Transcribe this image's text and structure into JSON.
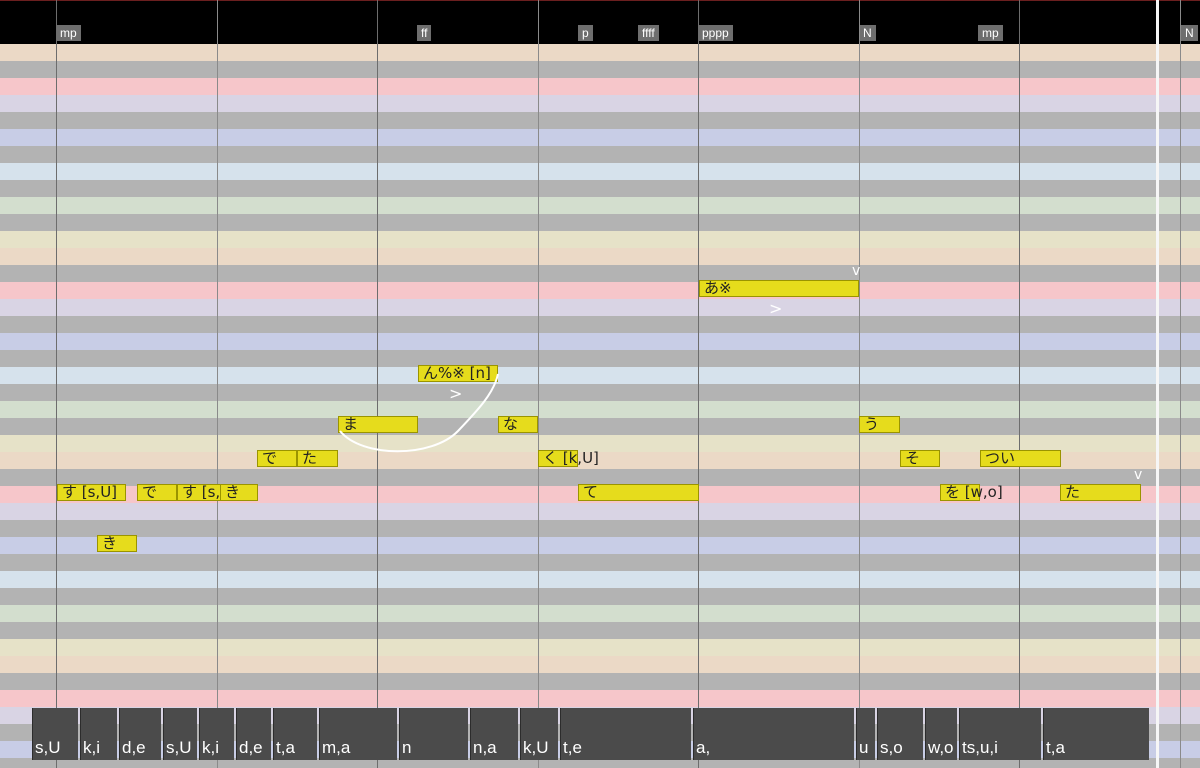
{
  "colors": {
    "note_fill": "#e6dc1c",
    "row_palette": [
      "#ebd9c6",
      "#b3b3b3",
      "#f6c6ca",
      "#d9d4e4",
      "#b3b3b3",
      "#c8cde6",
      "#b3b3b3",
      "#d6e2ec",
      "#b3b3b3",
      "#d3dece",
      "#b3b3b3",
      "#e6e2c8"
    ]
  },
  "dynamics": [
    "mp",
    "ff",
    "p",
    "ffff",
    "pppp",
    "N",
    "mp",
    "N"
  ],
  "notes": [
    {
      "lyric": "す [s,U]"
    },
    {
      "lyric": "で"
    },
    {
      "lyric": "す [s,"
    },
    {
      "lyric": "き"
    },
    {
      "lyric": "き"
    },
    {
      "lyric": "で"
    },
    {
      "lyric": "た"
    },
    {
      "lyric": "ま"
    },
    {
      "lyric": "ん%※ [n]"
    },
    {
      "lyric": "な"
    },
    {
      "lyric": "く [k,U]"
    },
    {
      "lyric": "て"
    },
    {
      "lyric": "あ※"
    },
    {
      "lyric": "う"
    },
    {
      "lyric": "そ"
    },
    {
      "lyric": "つい"
    },
    {
      "lyric": "を [w,o]"
    },
    {
      "lyric": "た"
    }
  ],
  "accents": [
    ">",
    ">"
  ],
  "accent_marks": [
    "v",
    "v"
  ],
  "phonemes": [
    "s,U",
    "k,i",
    "d,e",
    "s,U",
    "k,i",
    "d,e",
    "t,a",
    "m,a",
    "n",
    "n,a",
    "k,U",
    "t,e",
    "a,",
    "u",
    "s,o",
    "w,o",
    "ts,u,i",
    "t,a"
  ]
}
